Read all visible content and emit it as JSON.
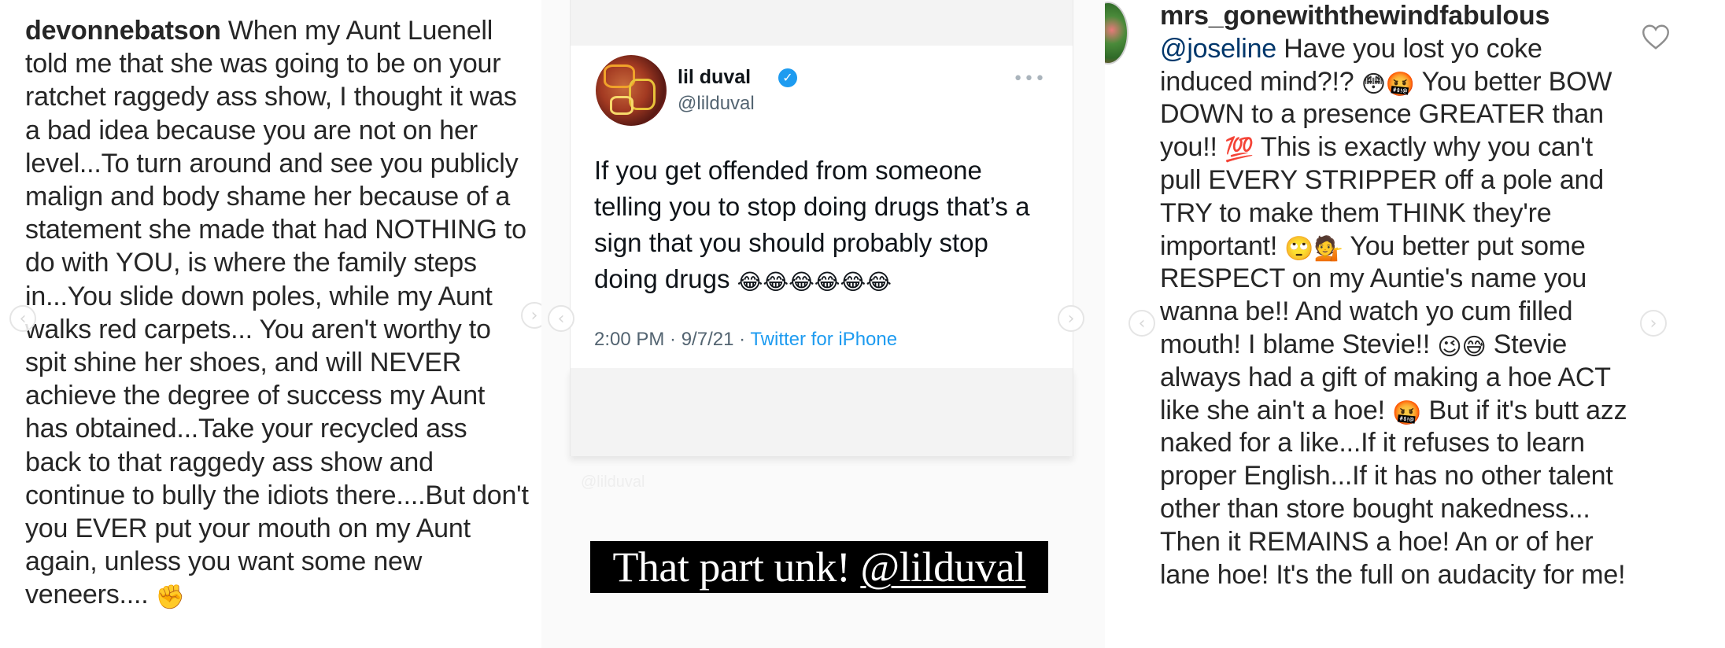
{
  "left_panel": {
    "username": "devonnebatson",
    "comment": "When my Aunt Luenell told me that she was going to be on your ratchet raggedy ass show, I thought it was a bad idea because you are not on her level...To turn around and see you publicly malign and body shame her because of a statement she made that had NOTHING to do with YOU, is where the family steps in...You slide down poles, while my Aunt walks red carpets... You aren't worthy to spit shine her shoes, and will NEVER achieve the degree of success my Aunt has obtained...Take your recycled ass back to that raggedy ass show and continue to bully the idiots there....But don't you EVER put your mouth on my Aunt again, unless you want some new veneers....",
    "trailing_emoji": "✊"
  },
  "tweet": {
    "display_name": "lil duval",
    "handle": "@lilduval",
    "more_icon": "more-horizontal-icon",
    "body": "If you get offended from someone telling you to stop doing drugs that’s a sign that you should probably stop doing drugs",
    "emojis": "😂😂😂😂😂😂",
    "time": "2:00 PM · 9/7/21 · ",
    "source": "Twitter for iPhone",
    "watermark": "@lilduval"
  },
  "caption": {
    "text": "That part unk! ",
    "mention": "@lilduval"
  },
  "right_panel": {
    "username": "mrs_gonewiththewindfabulous",
    "mention": "@joseline",
    "seg1": " Have you lost yo coke induced mind?!? ",
    "emo1": "😳🤬",
    "seg2": " You better BOW DOWN to a presence GREATER than you!! ",
    "emo2": "💯",
    "seg3": " This is exactly why you can't pull EVERY STRIPPER off a pole and TRY to make them THINK they're important! ",
    "emo3": "🙄💁",
    "seg4": " You better put some RESPECT on my Auntie's name you wanna be!! And watch yo cum filled mouth! I blame Stevie!! ",
    "emo4": "😉😅",
    "seg5": " Stevie always had a gift of making a hoe ACT like she ain't a hoe! ",
    "emo5": "🤬",
    "seg6": " But if it's butt azz naked for a like...If it refuses to learn proper English...If it has no other talent other than store bought nakedness... Then it REMAINS a hoe! An or of her lane hoe! It's the full on audacity for me!"
  },
  "nav": {
    "prev_glyph": "‹",
    "next_glyph": "›"
  },
  "icons": [
    "chevron-left-icon",
    "chevron-right-icon",
    "verified-badge-icon",
    "heart-icon"
  ],
  "colors": {
    "twitter_blue": "#1d9bf0",
    "instagram_mention": "#00376b",
    "caption_bg": "#000000"
  }
}
